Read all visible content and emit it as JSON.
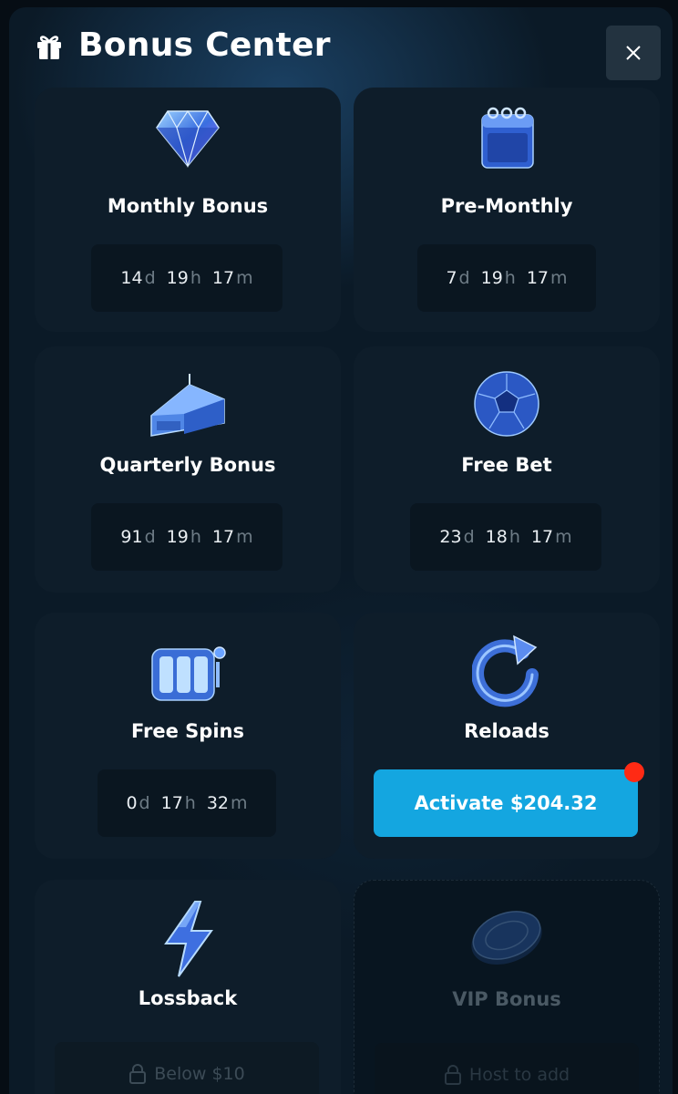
{
  "header": {
    "title": "Bonus Center",
    "gift_icon": "gift-icon",
    "close_icon": "close-icon"
  },
  "cards": [
    {
      "name": "Monthly Bonus",
      "icon": "diamond-icon",
      "timer": {
        "d": "14",
        "h": "19",
        "m": "17"
      }
    },
    {
      "name": "Pre-Monthly",
      "icon": "calendar-icon",
      "timer": {
        "d": "7",
        "h": "19",
        "m": "17"
      }
    },
    {
      "name": "Quarterly Bonus",
      "icon": "cake-icon",
      "timer": {
        "d": "91",
        "h": "19",
        "m": "17"
      }
    },
    {
      "name": "Free Bet",
      "icon": "soccer-ball-icon",
      "timer": {
        "d": "23",
        "h": "18",
        "m": "17"
      }
    },
    {
      "name": "Free Spins",
      "icon": "slot-machine-icon",
      "timer": {
        "d": "0",
        "h": "17",
        "m": "32"
      }
    },
    {
      "name": "Reloads",
      "icon": "reload-icon",
      "action": "Activate $204.32",
      "notification": true
    },
    {
      "name": "Lossback",
      "icon": "lightning-icon",
      "lock_text": "Below $10"
    },
    {
      "name": "VIP Bonus",
      "icon": "coin-icon",
      "lock_text": "Host to add",
      "locked": true
    }
  ],
  "units": {
    "d": "d",
    "h": "h",
    "m": "m"
  },
  "colors": {
    "accent": "#14a6e0",
    "notification": "#ff2a14",
    "card_bg": "#0e1d2a"
  }
}
